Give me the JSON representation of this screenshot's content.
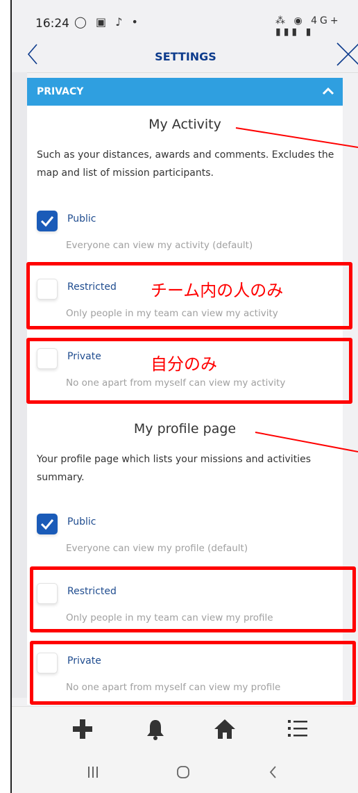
{
  "status_bar": {
    "time": "16:24",
    "left_icons": "◯ ▣ ♪ •",
    "right_icons": "⁂ ◉ 4G+ ▮▮▮ ▮"
  },
  "header": {
    "title": "SETTINGS"
  },
  "privacy_panel": {
    "title": "PRIVACY",
    "activity": {
      "title": "My Activity",
      "description": "Such as your distances, awards and comments. Excludes the map and list of mission participants.",
      "options": [
        {
          "label": "Public",
          "help": "Everyone can view my activity (default)",
          "checked": true
        },
        {
          "label": "Restricted",
          "help": "Only people in my team can view my activity",
          "checked": false
        },
        {
          "label": "Private",
          "help": "No one apart from myself can view my activity",
          "checked": false
        }
      ]
    },
    "profile": {
      "title": "My profile page",
      "description": "Your profile page which lists your missions and activities summary.",
      "options": [
        {
          "label": "Public",
          "help": "Everyone can view my profile (default)",
          "checked": true
        },
        {
          "label": "Restricted",
          "help": "Only people in my team can view my profile",
          "checked": false
        },
        {
          "label": "Private",
          "help": "No one apart from myself can view my profile",
          "checked": false
        }
      ]
    }
  },
  "annotations": {
    "restricted": "チーム内の人のみ",
    "private": "自分のみ"
  },
  "colors": {
    "accent": "#2f9fe0",
    "brand": "#0d3b8c",
    "checked": "#1a5bb8",
    "highlight": "#ff0000"
  },
  "bottom_bar": {
    "icons": [
      "plus-icon",
      "bell-icon",
      "home-icon",
      "list-icon"
    ]
  },
  "nav_bar": {
    "icons": [
      "recents-icon",
      "home-circle-icon",
      "back-chevron-icon"
    ]
  }
}
